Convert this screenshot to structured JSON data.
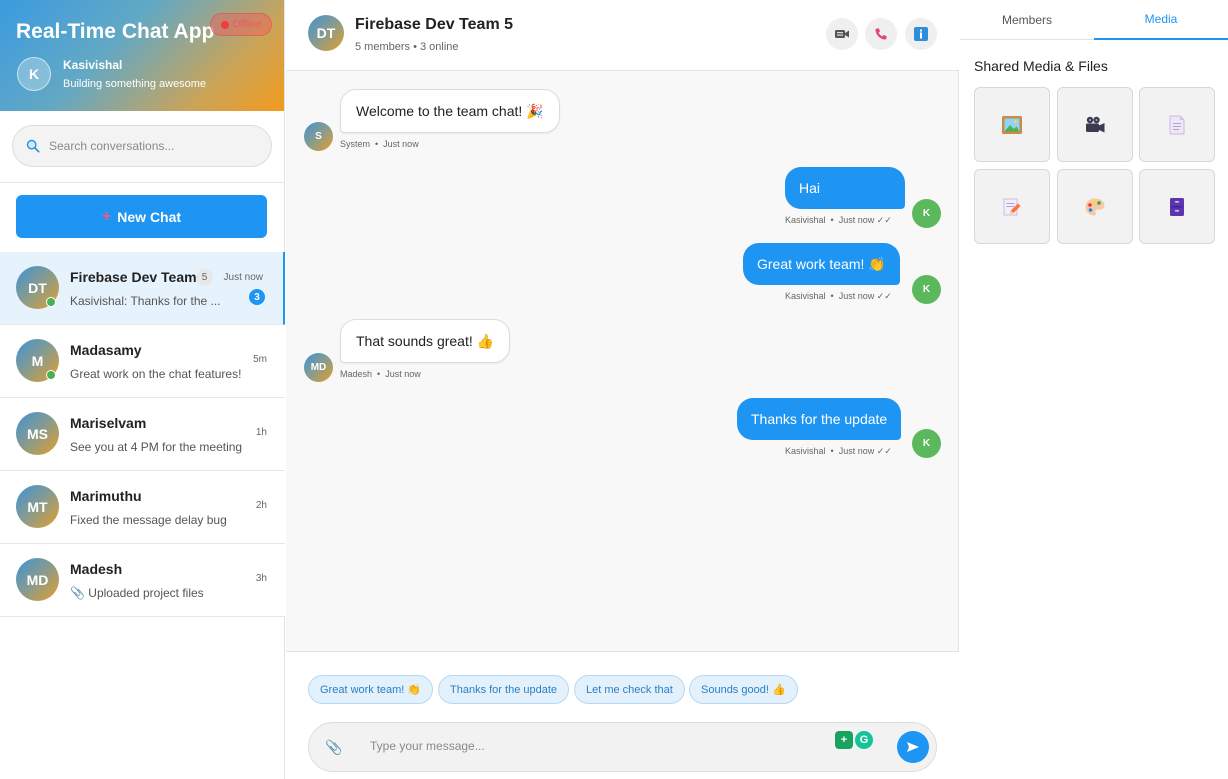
{
  "app": {
    "title": "Real-Time Chat App",
    "status": "Offline",
    "user": {
      "initial": "K",
      "name": "Kasivishal",
      "status": "Building something awesome"
    }
  },
  "search": {
    "placeholder": "Search conversations..."
  },
  "new_chat_label": "New Chat",
  "conversations": [
    {
      "initials": "DT",
      "name": "Firebase Dev Team",
      "member_count": "5",
      "preview": "Kasivishal: Thanks for the ...",
      "time": "Just now",
      "unread": "3",
      "online": true,
      "active": true
    },
    {
      "initials": "M",
      "name": "Madasamy",
      "preview": "Great work on the chat features!",
      "time": "5m",
      "online": true
    },
    {
      "initials": "MS",
      "name": "Mariselvam",
      "preview": "See you at 4 PM for the meeting",
      "time": "1h"
    },
    {
      "initials": "MT",
      "name": "Marimuthu",
      "preview": "Fixed the message delay bug",
      "time": "2h"
    },
    {
      "initials": "MD",
      "name": "Madesh",
      "preview": "📎 Uploaded project files",
      "time": "3h"
    }
  ],
  "chat": {
    "avatar": "DT",
    "title": "Firebase Dev Team 5",
    "subtitle": "5 members • 3 online",
    "actions": [
      "video-call-icon",
      "phone-icon",
      "info-icon"
    ]
  },
  "messages": [
    {
      "direction": "in",
      "avatar": "S",
      "text": "Welcome to the team chat! 🎉",
      "sender": "System",
      "time": "Just now"
    },
    {
      "direction": "out",
      "avatar": "K",
      "text": "Hai",
      "sender": "Kasivishal",
      "time": "Just now",
      "ticks": "✓✓"
    },
    {
      "direction": "out",
      "avatar": "K",
      "text": "Great work team! 👏",
      "sender": "Kasivishal",
      "time": "Just now",
      "ticks": "✓✓"
    },
    {
      "direction": "in",
      "avatar": "MD",
      "text": "That sounds great! 👍",
      "sender": "Madesh",
      "time": "Just now"
    },
    {
      "direction": "out",
      "avatar": "K",
      "text": "Thanks for the update",
      "sender": "Kasivishal",
      "time": "Just now",
      "ticks": "✓✓"
    }
  ],
  "quick_replies": [
    "Great work team! 👏",
    "Thanks for the update",
    "Let me check that",
    "Sounds good! 👍"
  ],
  "composer": {
    "placeholder": "Type your message...",
    "attach_icon": "📎",
    "ext_a": "+",
    "ext_b": "G"
  },
  "panel": {
    "tabs": [
      "Members",
      "Media"
    ],
    "active_tab": "Media",
    "title": "Shared Media & Files",
    "media": [
      {
        "icon": "🖼️",
        "name": "image-file-icon"
      },
      {
        "icon": "🎥",
        "name": "video-file-icon"
      },
      {
        "icon": "📄",
        "name": "document-file-icon"
      },
      {
        "icon": "📝",
        "name": "note-file-icon"
      },
      {
        "icon": "🎨",
        "name": "design-file-icon"
      },
      {
        "icon": "🗄️",
        "name": "archive-file-icon"
      }
    ]
  },
  "colors": {
    "accent": "#1e95f2",
    "online": "#4caf50",
    "offline": "#ef3d3d",
    "outgoing_avatar": "#5cb85c"
  }
}
